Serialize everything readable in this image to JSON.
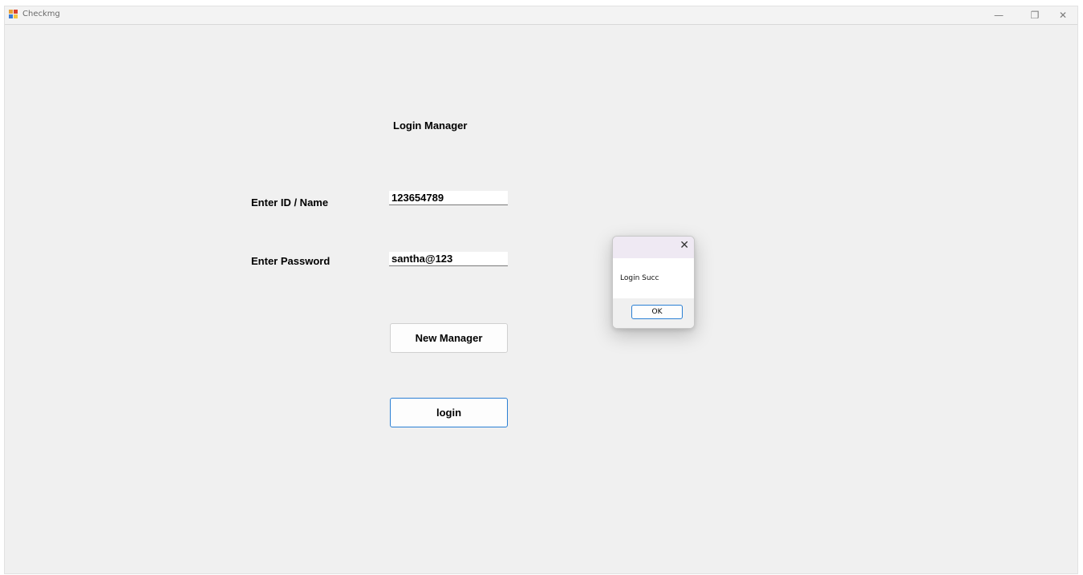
{
  "window": {
    "title": "Checkmg",
    "controls": {
      "minimize": "—",
      "restore": "❐",
      "close": "✕"
    }
  },
  "form": {
    "heading": "Login Manager",
    "id_label": "Enter ID / Name",
    "id_value": "123654789",
    "password_label": "Enter Password",
    "password_value": "santha@123",
    "new_manager_button": "New Manager",
    "login_button": "login"
  },
  "dialog": {
    "close": "✕",
    "message": "Login Succ",
    "ok_button": "OK"
  },
  "colors": {
    "window_bg": "#f0f0f0",
    "accent_border": "#2a7fd4",
    "dialog_titlebar": "#efe9f3"
  }
}
